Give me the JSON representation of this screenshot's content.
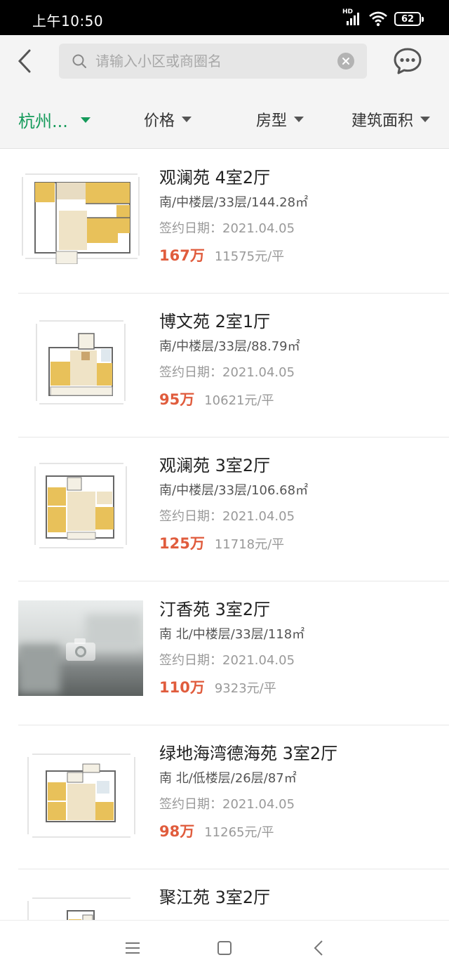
{
  "status_bar": {
    "time": "上午10:50",
    "network_badge": "HD",
    "battery": "62"
  },
  "header": {
    "search": {
      "placeholder": "请输入小区或商圈名",
      "value": ""
    }
  },
  "filters": [
    {
      "label": "杭州...",
      "active": true
    },
    {
      "label": "价格",
      "active": false
    },
    {
      "label": "房型",
      "active": false
    },
    {
      "label": "建筑面积",
      "active": false
    }
  ],
  "colors": {
    "accent_green": "#149a5a",
    "price_red": "#e05c3d",
    "header_bg": "#f4f4f4"
  },
  "listings": [
    {
      "title": "观澜苑 4室2厅",
      "detail": "南/中楼层/33层/144.28㎡",
      "date": "签约日期：2021.04.05",
      "price": "167万",
      "unit_price": "11575元/平",
      "thumb": "floorplan"
    },
    {
      "title": "博文苑 2室1厅",
      "detail": "南/中楼层/33层/88.79㎡",
      "date": "签约日期：2021.04.05",
      "price": "95万",
      "unit_price": "10621元/平",
      "thumb": "floorplan"
    },
    {
      "title": "观澜苑 3室2厅",
      "detail": "南/中楼层/33层/106.68㎡",
      "date": "签约日期：2021.04.05",
      "price": "125万",
      "unit_price": "11718元/平",
      "thumb": "floorplan"
    },
    {
      "title": "汀香苑 3室2厅",
      "detail": "南 北/中楼层/33层/118㎡",
      "date": "签约日期：2021.04.05",
      "price": "110万",
      "unit_price": "9323元/平",
      "thumb": "photo-placeholder"
    },
    {
      "title": "绿地海湾德海苑 3室2厅",
      "detail": "南 北/低楼层/26层/87㎡",
      "date": "签约日期：2021.04.05",
      "price": "98万",
      "unit_price": "11265元/平",
      "thumb": "floorplan"
    },
    {
      "title": "聚江苑 3室2厅",
      "detail": "",
      "date": "",
      "price": "",
      "unit_price": "",
      "thumb": "floorplan"
    }
  ],
  "nav": {
    "icons": [
      "menu-icon",
      "home-icon",
      "back-icon"
    ]
  }
}
